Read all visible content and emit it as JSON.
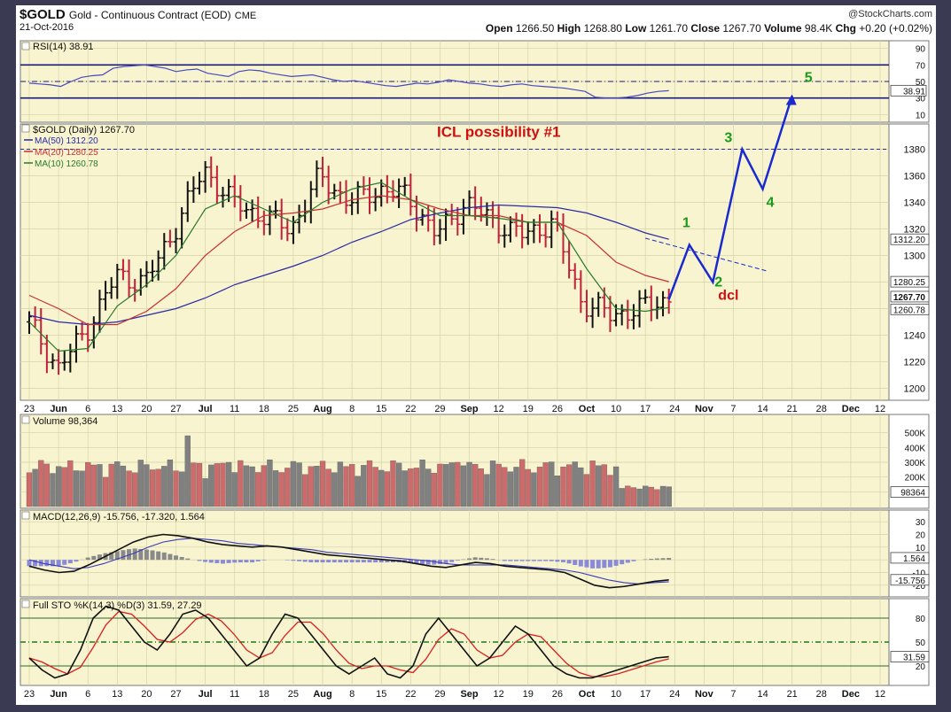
{
  "header": {
    "symbol": "$GOLD",
    "name": "Gold - Continuous Contract (EOD)",
    "exchange": "CME",
    "date": "21-Oct-2016",
    "brand": "@StockCharts.com",
    "ohlc": [
      {
        "label": "Open",
        "value": "1266.50"
      },
      {
        "label": "High",
        "value": "1268.80"
      },
      {
        "label": "Low",
        "value": "1261.70"
      },
      {
        "label": "Close",
        "value": "1267.70"
      },
      {
        "label": "Volume",
        "value": "98.4K"
      },
      {
        "label": "Chg",
        "value": "+0.20 (+0.02%)"
      }
    ]
  },
  "colors": {
    "panel_bg": "#f7f4cf",
    "grid": "#d6d2a8",
    "border": "#1a1a7a",
    "up": "#111111",
    "down": "#c0203a",
    "ma50": "#2a2aa8",
    "ma20": "#c83030",
    "ma10": "#2a7a2a",
    "rsi": "#4848c0",
    "wave_green": "#1a9a1a",
    "wave_red": "#d01010",
    "wave_blue": "#1a2ad0",
    "vol_up": "#808080",
    "vol_down": "#cc6b6b",
    "hist": "#8a8ad8",
    "stoch_k": "#111111",
    "stoch_d": "#d82020"
  },
  "xaxis": {
    "labels": [
      "23",
      "Jun",
      "6",
      "13",
      "20",
      "27",
      "Jul",
      "11",
      "18",
      "25",
      "Aug",
      "8",
      "15",
      "22",
      "29",
      "Sep",
      "12",
      "19",
      "26",
      "Oct",
      "10",
      "17",
      "24",
      "Nov",
      "7",
      "14",
      "21",
      "28",
      "Dec",
      "12"
    ],
    "bold": [
      "Jun",
      "Jul",
      "Aug",
      "Sep",
      "Oct",
      "Nov",
      "Dec"
    ]
  },
  "rsi_panel": {
    "title": "RSI(14) 38.91",
    "ticks": [
      "90",
      "70",
      "50",
      "30",
      "10"
    ],
    "current": "38.91"
  },
  "price_panel": {
    "title": "$GOLD (Daily) 1267.70",
    "legend": [
      {
        "label": "MA(50) 1312.20",
        "color": "#2a2aa8"
      },
      {
        "label": "MA(20) 1280.25",
        "color": "#c83030"
      },
      {
        "label": "MA(10) 1260.78",
        "color": "#2a7a2a"
      }
    ],
    "ticks": [
      "1380",
      "1360",
      "1340",
      "1320",
      "1300",
      "1280",
      "1260",
      "1240",
      "1220",
      "1200"
    ],
    "badges": [
      "1312.20",
      "1280.25",
      "1267.70",
      "1260.78"
    ],
    "annotation": "ICL possibility #1",
    "dcl_label": "dcl",
    "waves": [
      "1",
      "2",
      "3",
      "4",
      "5"
    ]
  },
  "volume_panel": {
    "title": "Volume 98,364",
    "ticks": [
      "500K",
      "400K",
      "300K",
      "200K",
      "100K"
    ],
    "current": "98364"
  },
  "macd_panel": {
    "title": "MACD(12,26,9) -15.756, -17.320, 1.564",
    "ticks": [
      "30",
      "20",
      "10",
      "0",
      "-10",
      "-20"
    ],
    "badges": [
      "1.564",
      "-15.756"
    ]
  },
  "stoch_panel": {
    "title": "Full STO %K(14,3) %D(3) 31.59, 27.29",
    "ticks": [
      "80",
      "50",
      "20"
    ],
    "current": "31.59"
  },
  "chart_data": {
    "type": "line",
    "title": "$GOLD Gold - Continuous Contract (EOD) CME",
    "x": [
      "May 23",
      "May 31",
      "Jun 6",
      "Jun 13",
      "Jun 20",
      "Jun 27",
      "Jul 5",
      "Jul 11",
      "Jul 18",
      "Jul 25",
      "Aug 1",
      "Aug 8",
      "Aug 15",
      "Aug 22",
      "Aug 29",
      "Sep 6",
      "Sep 12",
      "Sep 19",
      "Sep 26",
      "Oct 3",
      "Oct 10",
      "Oct 17",
      "Oct 21"
    ],
    "series": [
      {
        "name": "$GOLD (Daily)",
        "values": [
          1250,
          1215,
          1245,
          1285,
          1280,
          1320,
          1365,
          1340,
          1330,
          1320,
          1360,
          1340,
          1350,
          1345,
          1315,
          1340,
          1325,
          1315,
          1325,
          1265,
          1255,
          1260,
          1267.7
        ]
      },
      {
        "name": "MA(50)",
        "values": [
          1255,
          1250,
          1248,
          1250,
          1255,
          1260,
          1268,
          1278,
          1285,
          1292,
          1300,
          1310,
          1318,
          1327,
          1332,
          1336,
          1338,
          1337,
          1336,
          1332,
          1325,
          1317,
          1312.2
        ]
      },
      {
        "name": "MA(20)",
        "values": [
          1270,
          1260,
          1248,
          1248,
          1258,
          1275,
          1300,
          1318,
          1330,
          1332,
          1335,
          1342,
          1345,
          1342,
          1335,
          1330,
          1330,
          1325,
          1325,
          1315,
          1295,
          1285,
          1280.25
        ]
      },
      {
        "name": "MA(10)",
        "values": [
          1250,
          1228,
          1230,
          1262,
          1278,
          1300,
          1335,
          1345,
          1335,
          1325,
          1340,
          1350,
          1355,
          1342,
          1330,
          1330,
          1328,
          1325,
          1325,
          1290,
          1260,
          1258,
          1260.78
        ]
      }
    ],
    "projection": {
      "points": [
        [
          "Oct 21",
          1267
        ],
        [
          "Oct 26",
          1308
        ],
        [
          "Nov 1",
          1280
        ],
        [
          "Nov 8",
          1380
        ],
        [
          "Nov 14",
          1350
        ],
        [
          "Nov 21",
          1420
        ]
      ],
      "labels": [
        "1",
        "2",
        "3",
        "4",
        "5"
      ]
    },
    "indicators": {
      "RSI": 38.91,
      "MACD": -15.756,
      "MACD_signal": -17.32,
      "MACD_hist": 1.564,
      "STO_K": 31.59,
      "STO_D": 27.29,
      "Volume": 98364
    },
    "ylabel": "",
    "ylim": [
      1195,
      1395
    ]
  }
}
